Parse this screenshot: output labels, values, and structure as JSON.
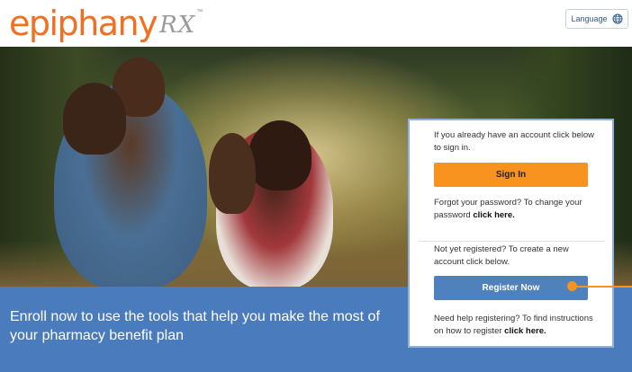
{
  "header": {
    "logo_main": "epiphany",
    "logo_rx": "RX",
    "logo_tm": "™",
    "language_label": "Language"
  },
  "hero": {
    "tagline": "Enroll now to use the tools that help you make the most of your pharmacy benefit plan"
  },
  "card": {
    "signin_prompt": "If you already have an account click below to sign in.",
    "signin_button": "Sign In",
    "forgot_text": "Forgot your password? To change your password ",
    "forgot_link": "click here.",
    "register_prompt": "Not yet registered? To create a new account click below.",
    "register_button": "Register Now",
    "help_text": "Need help registering? To find instructions on how to register ",
    "help_link": "click here."
  },
  "colors": {
    "brand_orange": "#f26f21",
    "button_orange": "#f7931e",
    "button_blue": "#4f81bd",
    "band_blue": "#4a7bbd"
  },
  "icons": {
    "language": "globe-icon"
  }
}
